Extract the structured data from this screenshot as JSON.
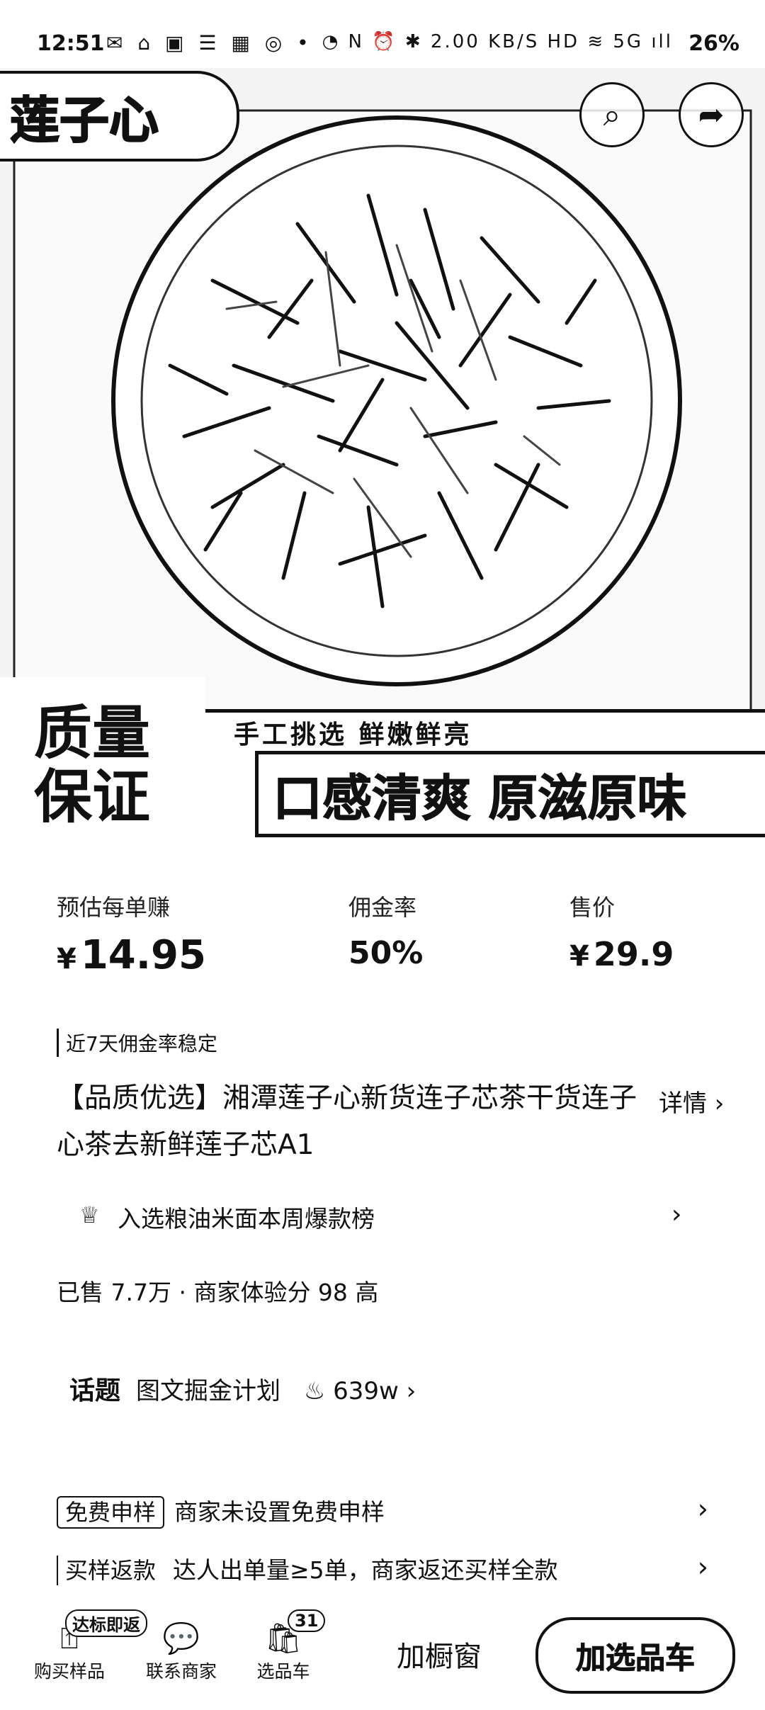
{
  "status_bar": {
    "time": "12:51",
    "left_icons": "✉ ⌂ ▣ ☰ ▦ ◎ •",
    "right_icons": "◔ N ⏰ ✱ 2.00 KB/S HD ≋ 5G ıll",
    "battery": "26%"
  },
  "hero": {
    "title": "莲子心",
    "quality_line1": "质量",
    "quality_line2": "保证",
    "slogan_small": "手工挑选  鲜嫩鲜亮",
    "slogan_big": "口感清爽 原滋原味"
  },
  "metrics": {
    "earn_label": "预估每单赚",
    "earn_currency": "¥",
    "earn_value": "14.95",
    "commission_label": "佣金率",
    "commission_value": "50%",
    "price_label": "售价",
    "price_currency": "¥",
    "price_value": "29.9"
  },
  "product": {
    "tag": "近7天佣金率稳定",
    "title": "【品质优选】湘潭莲子心新货连子芯茶干货连子心茶去新鲜莲子芯A1",
    "detail_label": "详情 ›",
    "rank_text": "入选粮油米面本周爆款榜",
    "sold_text": "已售 7.7万 · 商家体验分 98 高"
  },
  "topic": {
    "label": "话题",
    "name": "图文掘金计划",
    "heat": "639w ›"
  },
  "rows": [
    {
      "label": "免费申样",
      "text": "商家未设置免费申样"
    },
    {
      "label": "买样返款",
      "text": "达人出单量≥5单，商家返还买样全款"
    }
  ],
  "bottom_bar": {
    "buy_sample_badge": "达标即返",
    "buy_sample_label": "购买样品",
    "contact_label": "联系商家",
    "cart_badge": "31",
    "cart_label": "选品车",
    "window_button": "加橱窗",
    "add_cart_button": "加选品车"
  }
}
